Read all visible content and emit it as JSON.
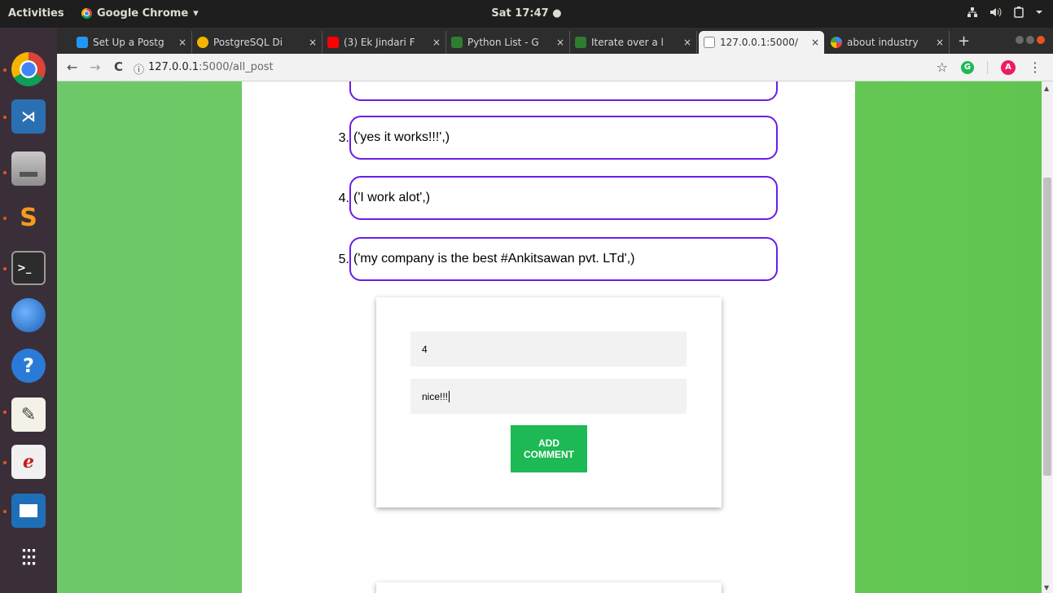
{
  "topbar": {
    "activities": "Activities",
    "app_name": "Google Chrome",
    "app_menu_arrow": "▾",
    "clock": "Sat 17:47",
    "clock_dot": "●",
    "tray": [
      "network-icon",
      "volume-icon",
      "battery-icon",
      "menu-arrow"
    ]
  },
  "dock": {
    "items": [
      "chrome",
      "vscode",
      "files",
      "sublime-text",
      "terminal",
      "thunderbird",
      "help",
      "text-editor",
      "evince",
      "libreoffice-impress"
    ],
    "show_apps": "⋮⋮⋮"
  },
  "tabs": [
    {
      "title": "Set Up a Postg",
      "favicon_color": "#2196f3"
    },
    {
      "title": "PostgreSQL Di",
      "favicon_color": "#f4b400"
    },
    {
      "title": "(3) Ek Jindari F",
      "favicon_color": "#ff0000"
    },
    {
      "title": "Python List - G",
      "favicon_color": "#2e7d32"
    },
    {
      "title": "Iterate over a l",
      "favicon_color": "#2e7d32"
    },
    {
      "title": "127.0.0.1:5000/",
      "favicon_color": "#dddddd",
      "active": true
    },
    {
      "title": "about industry",
      "favicon_color": "#4285f4"
    }
  ],
  "tab_close": "×",
  "new_tab": "+",
  "address": {
    "host": "127.0.0.1",
    "path": ":5000/all_post",
    "back": "←",
    "forward": "→",
    "reload": "C",
    "info": "ⓘ"
  },
  "toolbar_right": {
    "star": "☆",
    "grammarly": "G",
    "profile": "A",
    "menu": "⋮"
  },
  "posts": [
    {
      "number": "3.",
      "text": "('yes it works!!!',)"
    },
    {
      "number": "4.",
      "text": "('I work alot',)"
    },
    {
      "number": "5.",
      "text": "('my company is the best #Ankitsawan pvt. LTd',)"
    }
  ],
  "form": {
    "post_id_value": "4",
    "comment_value": "nice!!!",
    "button_label": "Add Comment"
  },
  "colors": {
    "post_border": "#6a1ee6",
    "button": "#1db954",
    "background_green": "#6ec96a"
  }
}
